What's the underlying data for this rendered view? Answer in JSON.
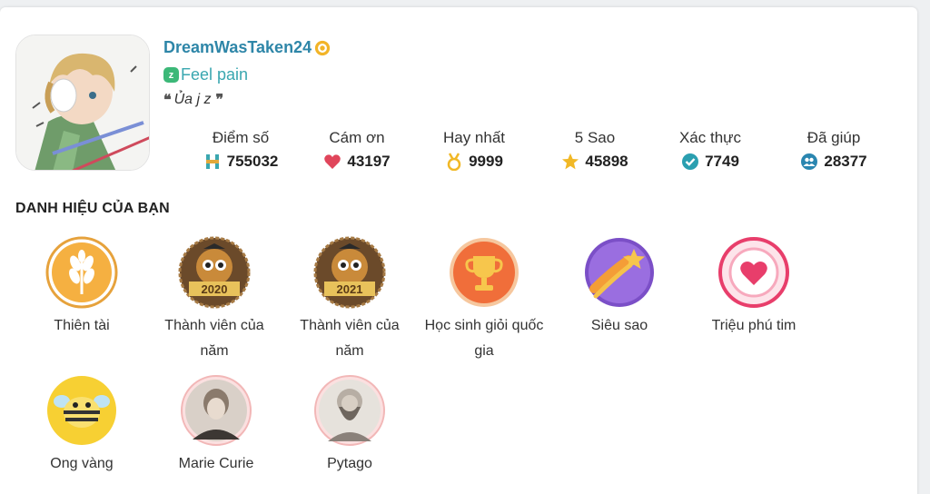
{
  "profile": {
    "username": "DreamWasTaken24",
    "status": "Feel pain",
    "status_icon_text": "z",
    "quote": "Ủa j z",
    "avatar_icon": "anime-avatar"
  },
  "stats": [
    {
      "label": "Điểm số",
      "value": "755032",
      "icon": "points-icon",
      "color": "#e2a93b"
    },
    {
      "label": "Cám ơn",
      "value": "43197",
      "icon": "heart-icon",
      "color": "#e0455b"
    },
    {
      "label": "Hay nhất",
      "value": "9999",
      "icon": "medal-icon",
      "color": "#f1b826"
    },
    {
      "label": "5 Sao",
      "value": "45898",
      "icon": "star-icon",
      "color": "#f1b826"
    },
    {
      "label": "Xác thực",
      "value": "7749",
      "icon": "verified-check-icon",
      "color": "#2a9fb0"
    },
    {
      "label": "Đã giúp",
      "value": "28377",
      "icon": "people-icon",
      "color": "#2a86b0"
    }
  ],
  "section_title": "DANH HIỆU CỦA BẠN",
  "badges": [
    {
      "name": "Thiên tài",
      "icon": "wheat-icon"
    },
    {
      "name": "Thành viên của năm",
      "year": "2020",
      "icon": "owl-2020-icon"
    },
    {
      "name": "Thành viên của năm",
      "year": "2021",
      "icon": "owl-2021-icon"
    },
    {
      "name": "Học sinh giỏi quốc gia",
      "icon": "trophy-icon"
    },
    {
      "name": "Siêu sao",
      "icon": "shooting-star-icon"
    },
    {
      "name": "Triệu phú tim",
      "icon": "heart-ring-icon"
    },
    {
      "name": "Ong vàng",
      "icon": "bee-icon"
    },
    {
      "name": "Marie Curie",
      "icon": "marie-curie-portrait-icon"
    },
    {
      "name": "Pytago",
      "icon": "pytago-portrait-icon"
    }
  ],
  "colors": {
    "username": "#2e86a8",
    "status": "#3aa7b0",
    "accent": "#3cb878"
  }
}
